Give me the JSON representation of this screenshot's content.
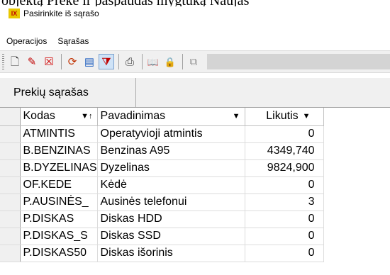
{
  "instruction_text": "objektą Prekė ir paspaudas mygtuką Naujas",
  "window": {
    "title": "Pasirinkite iš sąrašo",
    "icon_letters": "IX"
  },
  "menu": [
    "Operacijos",
    "Sąrašas"
  ],
  "toolbar": {
    "buttons": [
      {
        "icon": "new-document-icon",
        "glyph": "🗋"
      },
      {
        "icon": "edit-icon",
        "glyph": "✎"
      },
      {
        "icon": "delete-icon",
        "glyph": "☒"
      },
      {
        "icon": "refresh-icon",
        "glyph": "⟳"
      },
      {
        "icon": "form-icon",
        "glyph": "▤"
      },
      {
        "icon": "filter-icon",
        "glyph": "⧩"
      },
      {
        "icon": "print-preview-icon",
        "glyph": "⎙"
      },
      {
        "icon": "book-icon",
        "glyph": "📖"
      },
      {
        "icon": "lock-icon",
        "glyph": "🔒"
      },
      {
        "icon": "copy-icon",
        "glyph": "⧉"
      }
    ]
  },
  "tab": {
    "label": "Prekių sąrašas"
  },
  "table": {
    "columns": [
      {
        "label": "Kodas",
        "sort": "▼↑"
      },
      {
        "label": "Pavadinimas",
        "sort": "▼"
      },
      {
        "label": "Likutis",
        "sort": "▼"
      }
    ],
    "rows": [
      {
        "kodas": "ATMINTIS",
        "pavadinimas": "Operatyvioji atmintis",
        "likutis": "0"
      },
      {
        "kodas": "B.BENZINAS",
        "pavadinimas": "Benzinas A95",
        "likutis": "4349,740"
      },
      {
        "kodas": "B.DYZELINAS",
        "pavadinimas": "Dyzelinas",
        "likutis": "9824,900"
      },
      {
        "kodas": "OF.KEDE",
        "pavadinimas": "Kėdė",
        "likutis": "0"
      },
      {
        "kodas": "P.AUSINĖS_",
        "pavadinimas": "Ausinės telefonui",
        "likutis": "3"
      },
      {
        "kodas": "P.DISKAS",
        "pavadinimas": "Diskas HDD",
        "likutis": "0"
      },
      {
        "kodas": "P.DISKAS_S",
        "pavadinimas": "Diskas SSD",
        "likutis": "0"
      },
      {
        "kodas": "P.DISKAS50",
        "pavadinimas": "Diskas išorinis",
        "likutis": "0"
      }
    ]
  }
}
